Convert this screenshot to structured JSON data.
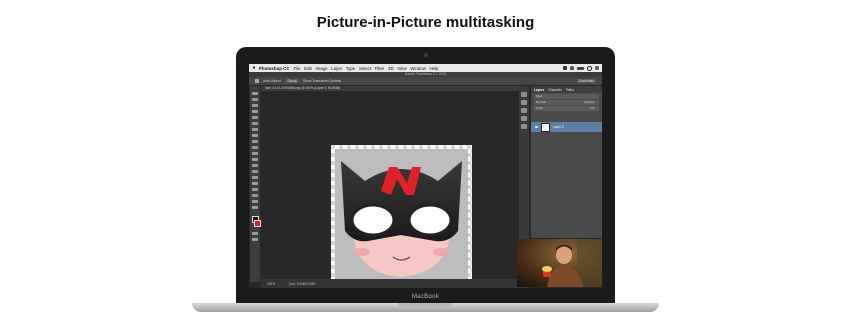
{
  "page": {
    "title": "Picture-in-Picture multitasking",
    "laptop_brand": "MacBook"
  },
  "menubar": {
    "apple_icon": "apple-icon",
    "app_name": "Photoshop CC",
    "items": [
      "File",
      "Edit",
      "Image",
      "Layer",
      "Type",
      "Select",
      "Filter",
      "3D",
      "View",
      "Window",
      "Help"
    ],
    "status_icons": [
      "font-icon",
      "wifi-icon",
      "battery-icon",
      "search-icon",
      "list-icon"
    ]
  },
  "photoshop": {
    "window_title": "Adobe Photoshop CC 2015",
    "options": {
      "auto_select": "Auto-Select:",
      "group": "Group",
      "show_transform": "Show Transform Controls"
    },
    "doc_tab": "luke_01-01-f47568fd.png @ 100% (Layer 0, RGB/8#)",
    "status": {
      "zoom": "100%",
      "doc": "Doc: 3.00M/3.00M"
    },
    "layers_panel": {
      "tabs": [
        "Layers",
        "Channels",
        "Paths"
      ],
      "kind": "Kind",
      "blend_mode": "Normal",
      "opacity": "Opacity:",
      "lock": "Lock:",
      "fill": "Fill:",
      "layer_name": "Layer 0"
    },
    "essentials": "Essentials"
  },
  "colors": {
    "accent_red": "#e0202a",
    "layer_selected": "#5d7fa8"
  }
}
